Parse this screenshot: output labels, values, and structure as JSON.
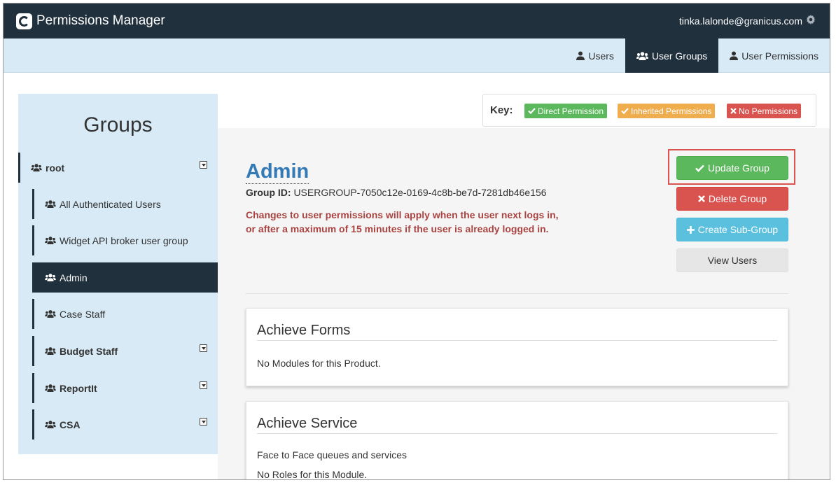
{
  "header": {
    "app_title": "Permissions Manager",
    "user_email": "tinka.lalonde@granicus.com"
  },
  "nav": {
    "tabs": [
      {
        "label": "Users"
      },
      {
        "label": "User Groups"
      },
      {
        "label": "User Permissions"
      }
    ]
  },
  "sidebar": {
    "title": "Groups",
    "root": "root",
    "items": [
      {
        "label": "All Authenticated Users"
      },
      {
        "label": "Widget API broker user group"
      },
      {
        "label": "Admin"
      },
      {
        "label": "Case Staff"
      },
      {
        "label": "Budget Staff"
      },
      {
        "label": "ReportIt"
      },
      {
        "label": "CSA"
      }
    ]
  },
  "key": {
    "label": "Key:",
    "direct": "Direct Permission",
    "inherited": "Inherited Permissions",
    "none": "No Permissions"
  },
  "group": {
    "title": "Admin",
    "id_label": "Group ID:",
    "id_value": "USERGROUP-7050c12e-0169-4c8b-be7d-7281db46e156",
    "warning": "Changes to user permissions will apply when the user next logs in, or after a maximum of 15 minutes if the user is already logged in."
  },
  "actions": {
    "update": "Update Group",
    "delete": "Delete Group",
    "create": "Create Sub-Group",
    "view": "View Users"
  },
  "products": [
    {
      "title": "Achieve Forms",
      "lines": [
        "No Modules for this Product."
      ]
    },
    {
      "title": "Achieve Service",
      "lines": [
        "Face to Face queues and services",
        "No Roles for this Module."
      ]
    }
  ],
  "colors": {
    "topbar": "#21303d",
    "navbar": "#d7eaf5",
    "link": "#337ab7",
    "success": "#5cb85c",
    "danger": "#d9534f",
    "info": "#5bc0de",
    "warning": "#f0ad4e"
  }
}
